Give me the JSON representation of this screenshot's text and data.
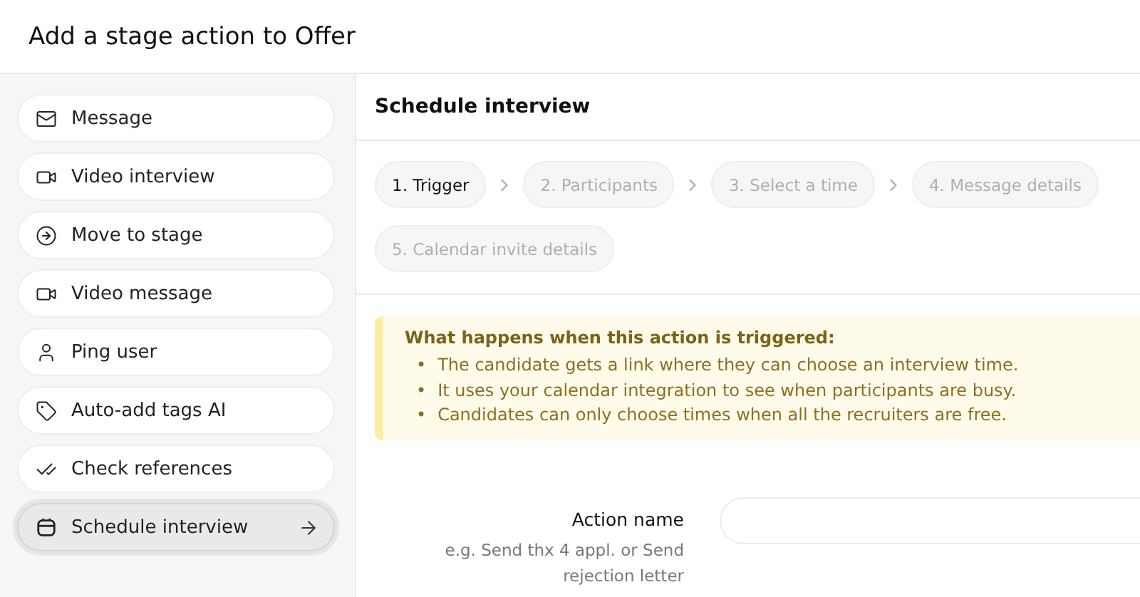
{
  "dialog": {
    "title": "Add a stage action to Offer"
  },
  "actions": [
    {
      "label": "Message",
      "kind": "mail",
      "selected": false
    },
    {
      "label": "Video interview",
      "kind": "video",
      "selected": false
    },
    {
      "label": "Move to stage",
      "kind": "move",
      "selected": false
    },
    {
      "label": "Video message",
      "kind": "video",
      "selected": false
    },
    {
      "label": "Ping user",
      "kind": "user",
      "selected": false
    },
    {
      "label": "Auto-add tags AI",
      "kind": "tag",
      "selected": false
    },
    {
      "label": "Check references",
      "kind": "check",
      "selected": false
    },
    {
      "label": "Schedule interview",
      "kind": "calendar",
      "selected": true
    }
  ],
  "panel": {
    "title": "Schedule interview",
    "steps": [
      {
        "label": "1. Trigger",
        "selected": true
      },
      {
        "label": "2. Participants",
        "selected": false
      },
      {
        "label": "3. Select a time",
        "selected": false
      },
      {
        "label": "4. Message details",
        "selected": false
      },
      {
        "label": "5. Calendar invite details",
        "selected": false
      }
    ],
    "notice": {
      "title": "What happens when this action is triggered:",
      "items": [
        {
          "bullet": "•",
          "text": "The candidate gets a link where they can choose an interview time."
        },
        {
          "bullet": "•",
          "text": "It uses your calendar integration to see when participants are busy."
        },
        {
          "bullet": "•",
          "text": "Candidates can only choose times when all the recruiters are free."
        }
      ]
    },
    "fields": [
      {
        "label": "Action name",
        "hint": "e.g. Send thx 4 appl. or Send rejection letter"
      }
    ]
  }
}
